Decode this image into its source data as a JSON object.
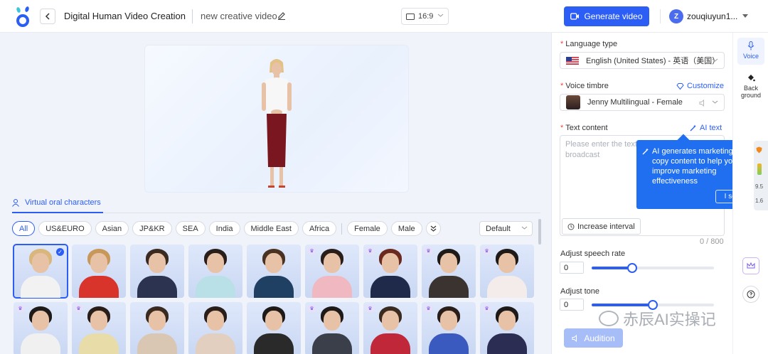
{
  "header": {
    "app_title": "Digital Human Video Creation",
    "doc_title": "new creative video",
    "aspect_ratio": "16:9",
    "generate_label": "Generate video",
    "user_initial": "Z",
    "username": "zouqiuyun1..."
  },
  "characters_section": {
    "tab_label": "Virtual oral characters",
    "filters": [
      "All",
      "US&EURO",
      "Asian",
      "JP&KR",
      "SEA",
      "India",
      "Middle East",
      "Africa"
    ],
    "gender_filters": [
      "Female",
      "Male"
    ],
    "active_filter": "All",
    "sort_value": "Default"
  },
  "settings": {
    "language_label": "Language type",
    "language_value": "English (United States) - 英语（美国）",
    "voice_label": "Voice timbre",
    "customize_label": "Customize",
    "voice_value": "Jenny Multilingual - Female",
    "text_label": "Text content",
    "ai_text_label": "AI text",
    "text_placeholder": "Please enter the text broadcast",
    "interval_label": "Increase interval",
    "counter": "0 / 800",
    "speech_rate_label": "Adjust speech rate",
    "speech_rate_value": "0",
    "speech_rate_fraction": 0.33,
    "tone_label": "Adjust tone",
    "tone_value": "0",
    "tone_fraction": 0.5,
    "audition_label": "Audition"
  },
  "tooltip": {
    "text": "AI generates marketing copy content to help you improve marketing effectiveness",
    "button": "I see"
  },
  "rail": {
    "voice_label": "Voice",
    "background_label_line1": "Back",
    "background_label_line2": "ground",
    "badge_top": "9.5",
    "badge_bottom": "1.6"
  },
  "watermark": "赤辰AI实操记",
  "colors": {
    "accent": "#2c5ef5",
    "tooltip": "#1f6ff0",
    "workspace_bg": "#f0f3f9"
  }
}
